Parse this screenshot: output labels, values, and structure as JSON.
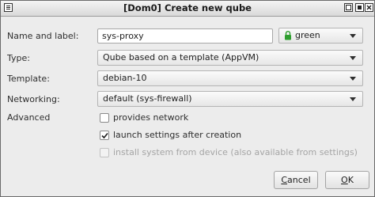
{
  "window": {
    "title": "[Dom0] Create new qube"
  },
  "form": {
    "name_label": "Name and label:",
    "name_value": "sys-proxy",
    "color_label": "green",
    "color_hex": "#2e9e2e",
    "type_label": "Type:",
    "type_value": "Qube based on a template (AppVM)",
    "template_label": "Template:",
    "template_value": "debian-10",
    "networking_label": "Networking:",
    "networking_value": "default (sys-firewall)",
    "advanced_label": "Advanced",
    "provides_network": {
      "label": "provides network",
      "checked": false
    },
    "launch_settings": {
      "label": "launch settings after creation",
      "checked": true
    },
    "install_system": {
      "label": "install system from device (also available from settings)",
      "checked": false,
      "disabled": true
    }
  },
  "buttons": {
    "cancel_first": "C",
    "cancel_rest": "ancel",
    "ok_first": "O",
    "ok_rest": "K"
  }
}
